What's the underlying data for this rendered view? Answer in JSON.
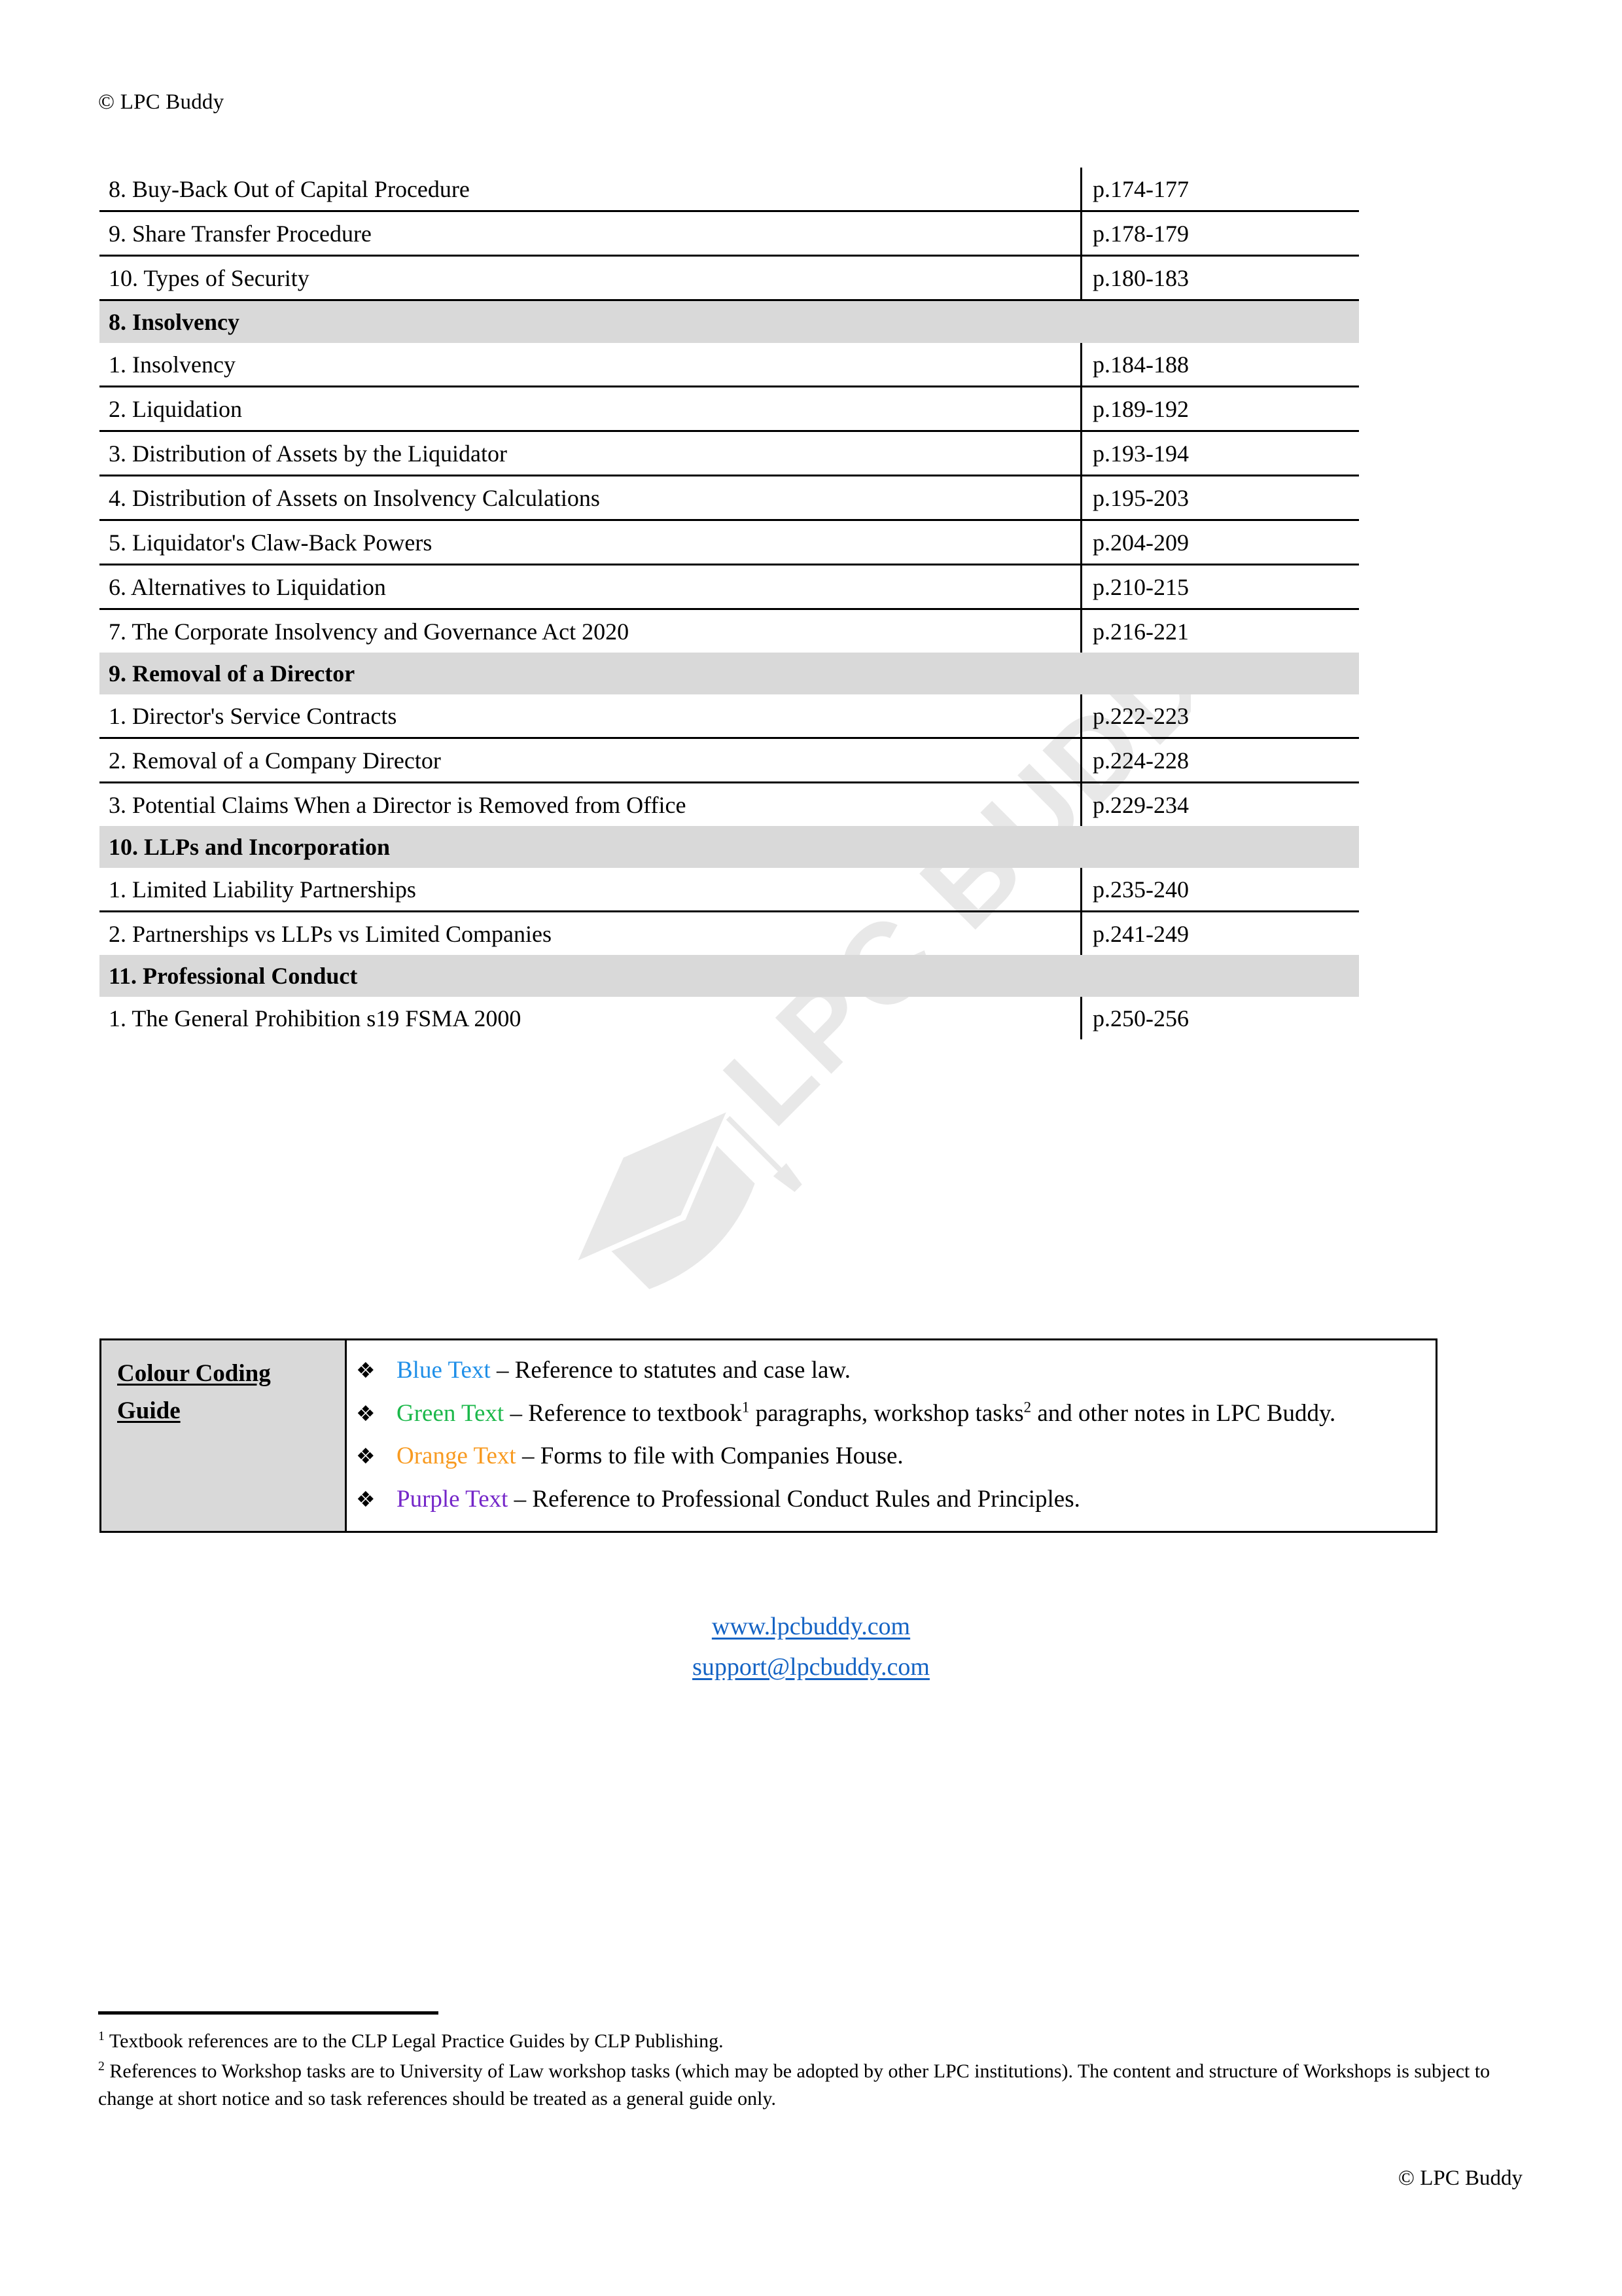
{
  "header": {
    "copyright": "© LPC Buddy"
  },
  "footer": {
    "copyright": "© LPC Buddy"
  },
  "toc": {
    "rows": [
      {
        "type": "item",
        "title": "8. Buy-Back Out of Capital Procedure",
        "pages": "p.174-177"
      },
      {
        "type": "item",
        "title": "9. Share Transfer Procedure",
        "pages": "p.178-179"
      },
      {
        "type": "item",
        "title": "10. Types of Security",
        "pages": "p.180-183"
      },
      {
        "type": "section",
        "title": "8. Insolvency",
        "pages": ""
      },
      {
        "type": "item",
        "title": "1. Insolvency",
        "pages": "p.184-188"
      },
      {
        "type": "item",
        "title": "2. Liquidation",
        "pages": "p.189-192"
      },
      {
        "type": "item",
        "title": "3. Distribution of Assets by the Liquidator",
        "pages": "p.193-194"
      },
      {
        "type": "item",
        "title": "4. Distribution of Assets on Insolvency Calculations",
        "pages": "p.195-203"
      },
      {
        "type": "item",
        "title": "5. Liquidator's Claw-Back Powers",
        "pages": "p.204-209"
      },
      {
        "type": "item",
        "title": "6. Alternatives to Liquidation",
        "pages": "p.210-215"
      },
      {
        "type": "item",
        "title": "7. The Corporate Insolvency and Governance Act 2020",
        "pages": "p.216-221"
      },
      {
        "type": "section",
        "title": "9. Removal of a Director",
        "pages": ""
      },
      {
        "type": "item",
        "title": "1. Director's Service Contracts",
        "pages": "p.222-223"
      },
      {
        "type": "item",
        "title": "2. Removal of a Company Director",
        "pages": "p.224-228"
      },
      {
        "type": "item",
        "title": "3. Potential Claims When a Director is Removed from Office",
        "pages": "p.229-234"
      },
      {
        "type": "section",
        "title": "10. LLPs and Incorporation",
        "pages": ""
      },
      {
        "type": "item",
        "title": "1. Limited Liability Partnerships",
        "pages": "p.235-240"
      },
      {
        "type": "item",
        "title": "2. Partnerships vs LLPs vs Limited Companies",
        "pages": "p.241-249"
      },
      {
        "type": "section",
        "title": "11. Professional Conduct",
        "pages": ""
      },
      {
        "type": "item",
        "title": "1. The General Prohibition s19 FSMA 2000",
        "pages": "p.250-256",
        "last": true
      }
    ]
  },
  "guide": {
    "label_line1": "Colour Coding",
    "label_line2": "Guide",
    "bullet_glyph": "❖",
    "entries": [
      {
        "color_name": "Blue Text",
        "color_hex": "#1f8fe8",
        "description": " – Reference to statutes and case law."
      },
      {
        "color_name": "Green Text",
        "color_hex": "#1bb84a",
        "desc_part1": " – Reference to textbook",
        "sup1": "1",
        "desc_part2": " paragraphs, workshop tasks",
        "sup2": "2",
        "desc_part3": " and other notes in LPC Buddy."
      },
      {
        "color_name": "Orange Text",
        "color_hex": "#f89a20",
        "description": " – Forms to file with Companies House."
      },
      {
        "color_name": "Purple Text",
        "color_hex": "#7527c9",
        "description": " – Reference to Professional Conduct Rules and Principles."
      }
    ]
  },
  "contact": {
    "website": "www.lpcbuddy.com",
    "email": "support@lpcbuddy.com",
    "link_color": "#1463c4"
  },
  "footnotes": {
    "note1_marker": "1",
    "note1_text": " Textbook references are to the CLP Legal Practice Guides by CLP Publishing.",
    "note2_marker": "2",
    "note2_text": " References to Workshop tasks are to University of Law workshop tasks (which may be adopted by other LPC institutions). The content and structure of Workshops is subject to change at short notice and so task references should be treated as a general guide only."
  },
  "watermark": {
    "text": "LPC BUDDY",
    "color": "#e8e8e8"
  },
  "palette": {
    "section_shading": "#d9d9d9",
    "rule": "#000000"
  }
}
